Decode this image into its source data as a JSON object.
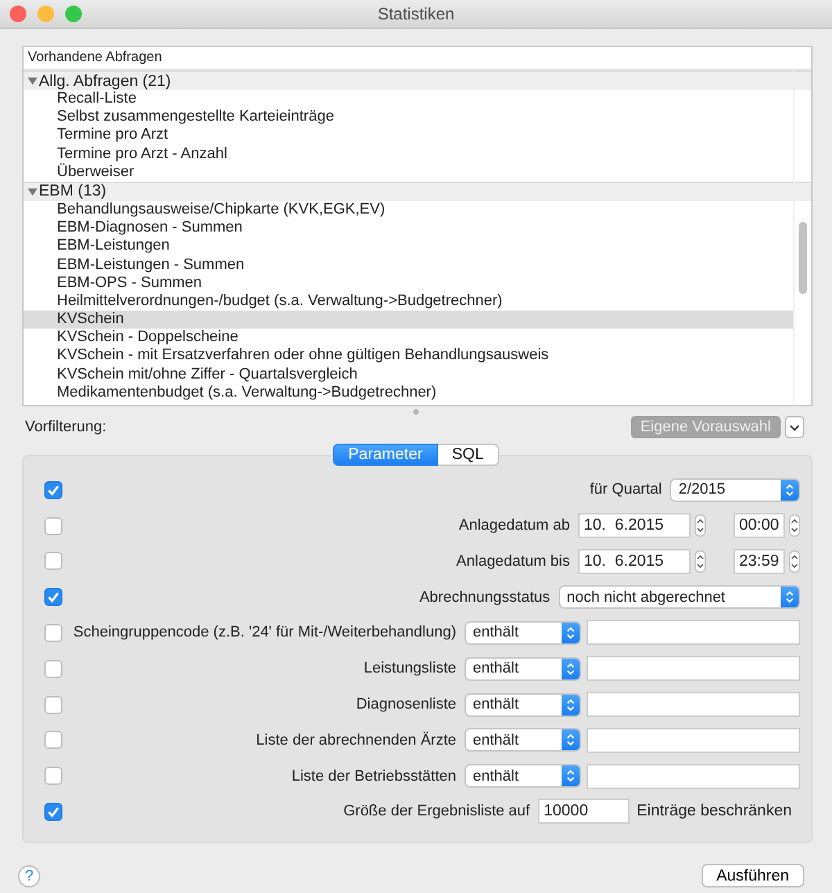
{
  "window": {
    "title": "Statistiken"
  },
  "queries": {
    "header": "Vorhandene Abfragen",
    "groups": [
      {
        "label": "Allg. Abfragen (21)",
        "expanded": true,
        "children": [
          {
            "label": "Recall-Liste",
            "selected": false
          },
          {
            "label": "Selbst zusammengestellte Karteieinträge",
            "selected": false
          },
          {
            "label": "Termine pro Arzt",
            "selected": false
          },
          {
            "label": "Termine pro Arzt - Anzahl",
            "selected": false
          },
          {
            "label": "Überweiser",
            "selected": false
          }
        ]
      },
      {
        "label": "EBM (13)",
        "expanded": true,
        "children": [
          {
            "label": "Behandlungsausweise/Chipkarte (KVK,EGK,EV)",
            "selected": false
          },
          {
            "label": "EBM-Diagnosen - Summen",
            "selected": false
          },
          {
            "label": "EBM-Leistungen",
            "selected": false
          },
          {
            "label": "EBM-Leistungen - Summen",
            "selected": false
          },
          {
            "label": "EBM-OPS - Summen",
            "selected": false
          },
          {
            "label": "Heilmittelverordnungen-/budget (s.a. Verwaltung->Budgetrechner)",
            "selected": false
          },
          {
            "label": "KVSchein",
            "selected": true
          },
          {
            "label": "KVSchein - Doppelscheine",
            "selected": false
          },
          {
            "label": "KVSchein - mit Ersatzverfahren oder ohne gültigen Behandlungsausweis",
            "selected": false
          },
          {
            "label": "KVSchein mit/ohne Ziffer - Quartalsvergleich",
            "selected": false
          },
          {
            "label": "Medikamentenbudget (s.a. Verwaltung->Budgetrechner)",
            "selected": false
          }
        ]
      }
    ]
  },
  "prefilter": {
    "label": "Vorfilterung:",
    "button": "Eigene Vorauswahl",
    "button_disabled": true
  },
  "tabs": [
    {
      "label": "Parameter",
      "selected": true
    },
    {
      "label": "SQL",
      "selected": false
    }
  ],
  "parameters": [
    {
      "kind": "select",
      "checked": true,
      "label": "für Quartal",
      "value": "2/2015"
    },
    {
      "kind": "datetime",
      "checked": false,
      "label": "Anlagedatum ab",
      "date": "10.  6.2015",
      "time": "00:00"
    },
    {
      "kind": "datetime",
      "checked": false,
      "label": "Anlagedatum bis",
      "date": "10.  6.2015",
      "time": "23:59"
    },
    {
      "kind": "select",
      "checked": true,
      "label": "Abrechnungsstatus",
      "value": "noch nicht abgerechnet"
    },
    {
      "kind": "filter",
      "checked": false,
      "label": "Scheingruppencode (z.B. '24' für Mit-/Weiterbehandlung)",
      "operator": "enthält"
    },
    {
      "kind": "filter",
      "checked": false,
      "label": "Leistungsliste",
      "operator": "enthält"
    },
    {
      "kind": "filter",
      "checked": false,
      "label": "Diagnosenliste",
      "operator": "enthält"
    },
    {
      "kind": "filter",
      "checked": false,
      "label": "Liste der abrechnenden Ärzte",
      "operator": "enthält"
    },
    {
      "kind": "filter",
      "checked": false,
      "label": "Liste der Betriebsstätten",
      "operator": "enthält"
    },
    {
      "kind": "limit",
      "checked": true,
      "label": "Größe der Ergebnisliste auf",
      "value": "10000",
      "suffix": "Einträge beschränken"
    }
  ],
  "buttons": {
    "help": "?",
    "run": "Ausführen"
  }
}
